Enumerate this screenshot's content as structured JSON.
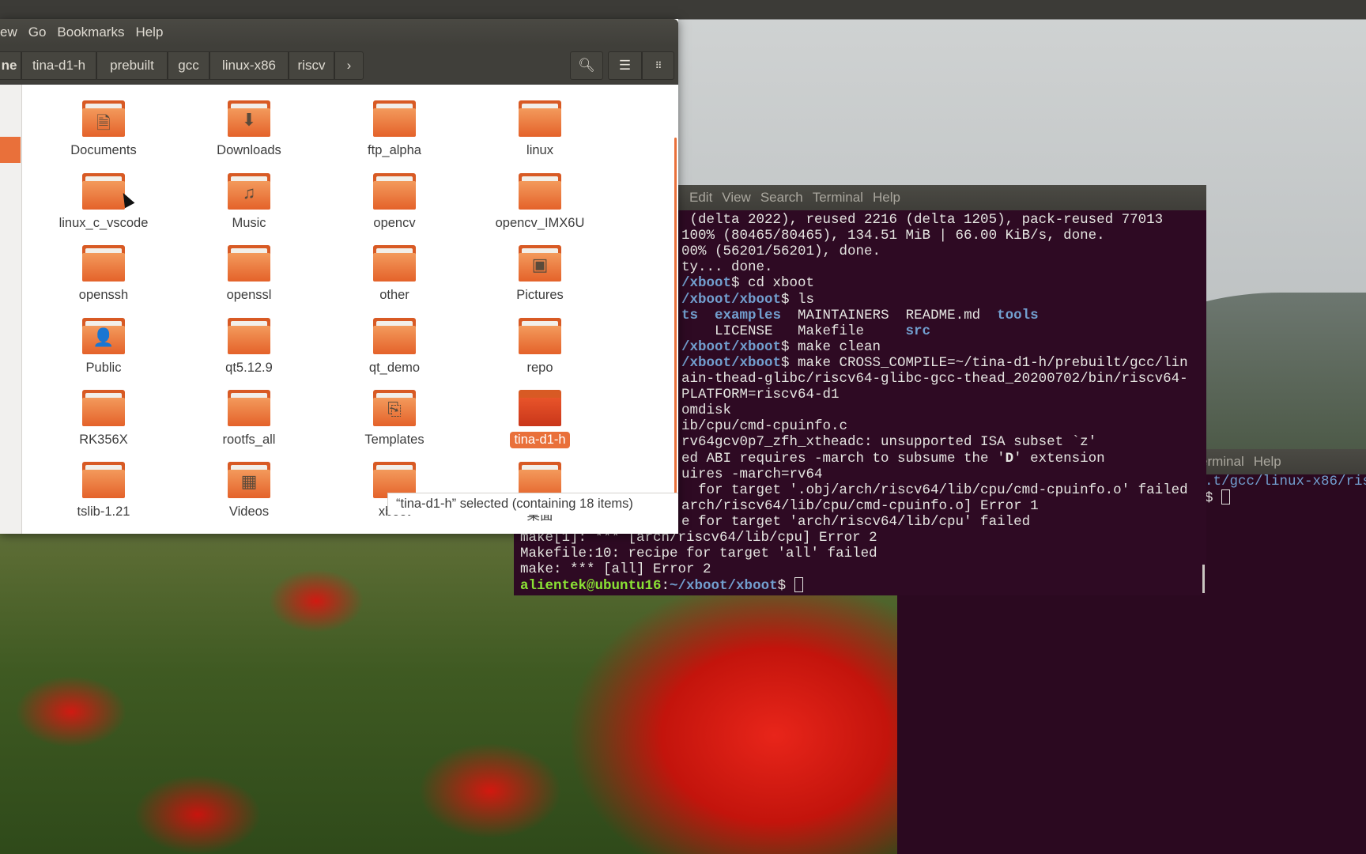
{
  "file_manager": {
    "menu": [
      "ew",
      "Go",
      "Bookmarks",
      "Help"
    ],
    "breadcrumb": [
      "ne",
      "tina-d1-h",
      "prebuilt",
      "gcc",
      "linux-x86",
      "riscv"
    ],
    "breadcrumb_more": "›",
    "search_icon": "search-icon",
    "list_icon": "list-view-icon",
    "grid_icon": "grid-view-icon",
    "items": [
      {
        "name": "Documents",
        "icon": "documents"
      },
      {
        "name": "Downloads",
        "icon": "downloads"
      },
      {
        "name": "ftp_alpha",
        "icon": "folder"
      },
      {
        "name": "linux",
        "icon": "folder"
      },
      {
        "name": "linux_c_vscode",
        "icon": "folder"
      },
      {
        "name": "Music",
        "icon": "music"
      },
      {
        "name": "opencv",
        "icon": "folder"
      },
      {
        "name": "opencv_IMX6U",
        "icon": "folder"
      },
      {
        "name": "openssh",
        "icon": "folder"
      },
      {
        "name": "openssl",
        "icon": "folder"
      },
      {
        "name": "other",
        "icon": "folder"
      },
      {
        "name": "Pictures",
        "icon": "pictures"
      },
      {
        "name": "Public",
        "icon": "public"
      },
      {
        "name": "qt5.12.9",
        "icon": "folder"
      },
      {
        "name": "qt_demo",
        "icon": "folder"
      },
      {
        "name": "repo",
        "icon": "folder"
      },
      {
        "name": "RK356X",
        "icon": "folder"
      },
      {
        "name": "rootfs_all",
        "icon": "folder"
      },
      {
        "name": "Templates",
        "icon": "templates"
      },
      {
        "name": "tina-d1-h",
        "icon": "folder",
        "selected": true
      },
      {
        "name": "tslib-1.21",
        "icon": "folder"
      },
      {
        "name": "Videos",
        "icon": "videos"
      },
      {
        "name": "xboot",
        "icon": "folder"
      },
      {
        "name": "桌面",
        "icon": "folder"
      }
    ],
    "status": "“tina-d1-h” selected  (containing 18 items)",
    "accent": "#e9703a"
  },
  "terminal_front": {
    "menu": [
      "Edit",
      "View",
      "Search",
      "Terminal",
      "Help"
    ],
    "clipped_lines": [
      [
        {
          "t": " (delta 2022), reused 2216 (delta 1205), pack-reused 77013"
        }
      ],
      [
        {
          "t": "100% (80465/80465), 134.51 MiB | 66.00 KiB/s, done."
        }
      ],
      [
        {
          "t": "00% (56201/56201), done."
        }
      ],
      [
        {
          "t": "ty... done."
        }
      ],
      [
        {
          "t": "/xboot",
          "c": "b"
        },
        {
          "t": "$ cd xboot"
        }
      ],
      [
        {
          "t": "/xboot/xboot",
          "c": "b"
        },
        {
          "t": "$ ls"
        }
      ],
      [
        {
          "t": "ts",
          "c": "b"
        },
        {
          "t": "  "
        },
        {
          "t": "examples",
          "c": "b"
        },
        {
          "t": "  MAINTAINERS  README.md  "
        },
        {
          "t": "tools",
          "c": "b"
        }
      ],
      [
        {
          "t": "    LICENSE   Makefile     "
        },
        {
          "t": "src",
          "c": "b"
        }
      ],
      [
        {
          "t": "/xboot/xboot",
          "c": "b"
        },
        {
          "t": "$ make clean"
        }
      ],
      [
        {
          "t": "/xboot/xboot",
          "c": "b"
        },
        {
          "t": "$ make CROSS_COMPILE=~/tina-d1-h/prebuilt/gcc/lin"
        }
      ],
      [
        {
          "t": "ain-thead-glibc/riscv64-glibc-gcc-thead_20200702/bin/riscv64-"
        }
      ],
      [
        {
          "t": "PLATFORM=riscv64-d1"
        }
      ],
      [
        {
          "t": "omdisk"
        }
      ],
      [
        {
          "t": "ib/cpu/cmd-cpuinfo.c"
        }
      ],
      [
        {
          "t": "rv64gcv0p7_zfh_xtheadc: unsupported ISA subset `z'"
        }
      ],
      [
        {
          "t": "ed ABI requires -march to subsume the '"
        },
        {
          "t": "D",
          "c": "w"
        },
        {
          "t": "' extension"
        }
      ],
      [
        {
          "t": "uires -march=rv64"
        }
      ],
      [
        {
          "t": "  for target '.obj/arch/riscv64/lib/cpu/cmd-cpuinfo.o' failed"
        }
      ],
      [
        {
          "t": "arch/riscv64/lib/cpu/cmd-cpuinfo.o] Error 1"
        }
      ],
      [
        {
          "t": "e for target 'arch/riscv64/lib/cpu' failed"
        }
      ]
    ],
    "full_lines": [
      [
        {
          "t": "make[1]: *** [arch/riscv64/lib/cpu] Error 2"
        }
      ],
      [
        {
          "t": "Makefile:10: recipe for target 'all' failed"
        }
      ],
      [
        {
          "t": "make: *** [all] Error 2"
        }
      ],
      [
        {
          "t": "alientek@ubuntu16",
          "c": "g"
        },
        {
          "t": ":"
        },
        {
          "t": "~/xboot/xboot",
          "c": "b"
        },
        {
          "t": "$ "
        },
        {
          "cursor": true
        }
      ]
    ]
  },
  "terminal_back": {
    "menu": [
      "erminal",
      "Help"
    ],
    "lines": [
      [
        {
          "t": ".t/gcc/linux-x86/ris",
          "c": "bl"
        }
      ],
      [
        {
          "t": "$ "
        },
        {
          "cursor": true
        }
      ]
    ]
  },
  "colors": {
    "terminal_bg": "#2e0a23",
    "prompt_user": "#8ae234",
    "prompt_path": "#729fcf"
  }
}
